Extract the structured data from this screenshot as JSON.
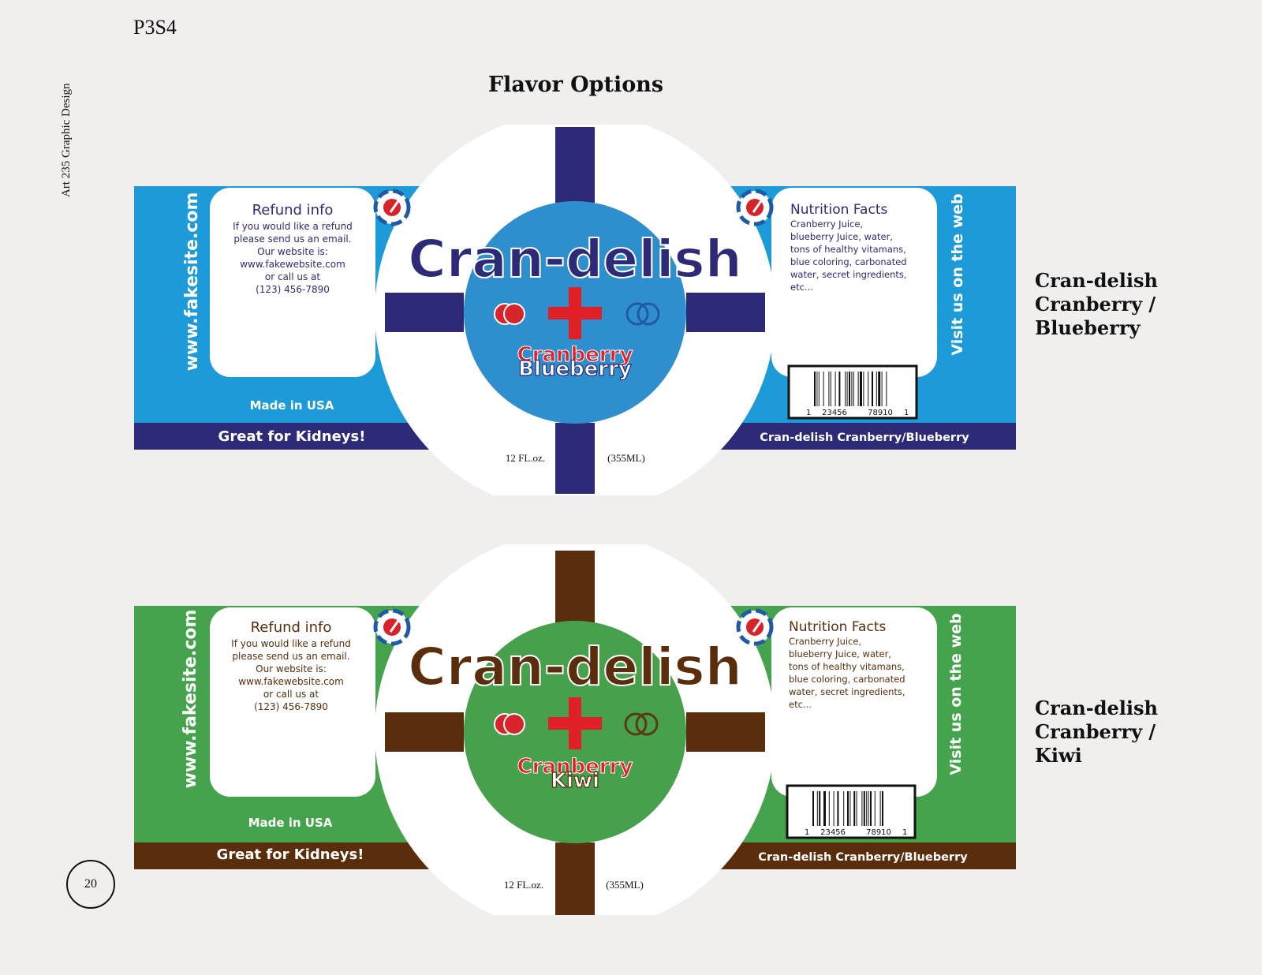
{
  "page": {
    "code": "P3S4",
    "side_label": "Art 235 Graphic Design",
    "title": "Flavor Options",
    "page_number": "20"
  },
  "labels": [
    {
      "colors": {
        "main": "#1d9ad8",
        "dark": "#2d2a77",
        "circle": "#2f8fce",
        "brand": "#2d2a77",
        "flavor2": "#ffffff",
        "ring": "#1f5aa8"
      },
      "brand": "Cran-delish",
      "flavor_top": "Cranberry",
      "flavor_bottom": "Blueberry",
      "volume_left": "12 FL.oz.",
      "volume_right": "(355ML)",
      "website_vertical": "www.fakesite.com",
      "refund_title": "Refund info",
      "refund_lines": [
        "If you would like a refund",
        "please send us an email.",
        "Our website is:",
        "www.fakewebsite.com",
        "or call us at",
        "(123) 456-7890"
      ],
      "made_in": "Made in USA",
      "slogan": "Great for Kidneys!",
      "nutrition_title": "Nutrition Facts",
      "nutrition_lines": [
        "Cranberry Juice,",
        "blueberry Juice, water,",
        "tons of healthy vitamans,",
        "blue coloring, carbonated",
        "water, secret ingredients,",
        "etc..."
      ],
      "visit_vertical": "Visit us on the web",
      "barcode_left": "1",
      "barcode_mid1": "23456",
      "barcode_mid2": "78910",
      "barcode_right": "1",
      "product_bar": "Cran-delish Cranberry/Blueberry",
      "caption": [
        "Cran-delish",
        "Cranberry /",
        "Blueberry"
      ]
    },
    {
      "colors": {
        "main": "#45a34d",
        "dark": "#5a2d0c",
        "circle": "#46a04c",
        "brand": "#5a2d0c",
        "flavor2": "#ffffff",
        "ring": "#5a3a10"
      },
      "brand": "Cran-delish",
      "flavor_top": "Cranberry",
      "flavor_bottom": "Kiwi",
      "volume_left": "12 FL.oz.",
      "volume_right": "(355ML)",
      "website_vertical": "www.fakesite.com",
      "refund_title": "Refund info",
      "refund_lines": [
        "If you would like a refund",
        "please send us an email.",
        "Our website is:",
        "www.fakewebsite.com",
        "or call us at",
        "(123) 456-7890"
      ],
      "made_in": "Made in USA",
      "slogan": "Great for Kidneys!",
      "nutrition_title": "Nutrition Facts",
      "nutrition_lines": [
        "Cranberry Juice,",
        "blueberry Juice, water,",
        "tons of healthy vitamans,",
        "blue coloring, carbonated",
        "water, secret ingredients,",
        "etc..."
      ],
      "visit_vertical": "Visit us on the web",
      "barcode_left": "1",
      "barcode_mid1": "23456",
      "barcode_mid2": "78910",
      "barcode_right": "1",
      "product_bar": "Cran-delish Cranberry/Blueberry",
      "caption": [
        "Cran-delish",
        "Cranberry /",
        "Kiwi"
      ]
    }
  ]
}
